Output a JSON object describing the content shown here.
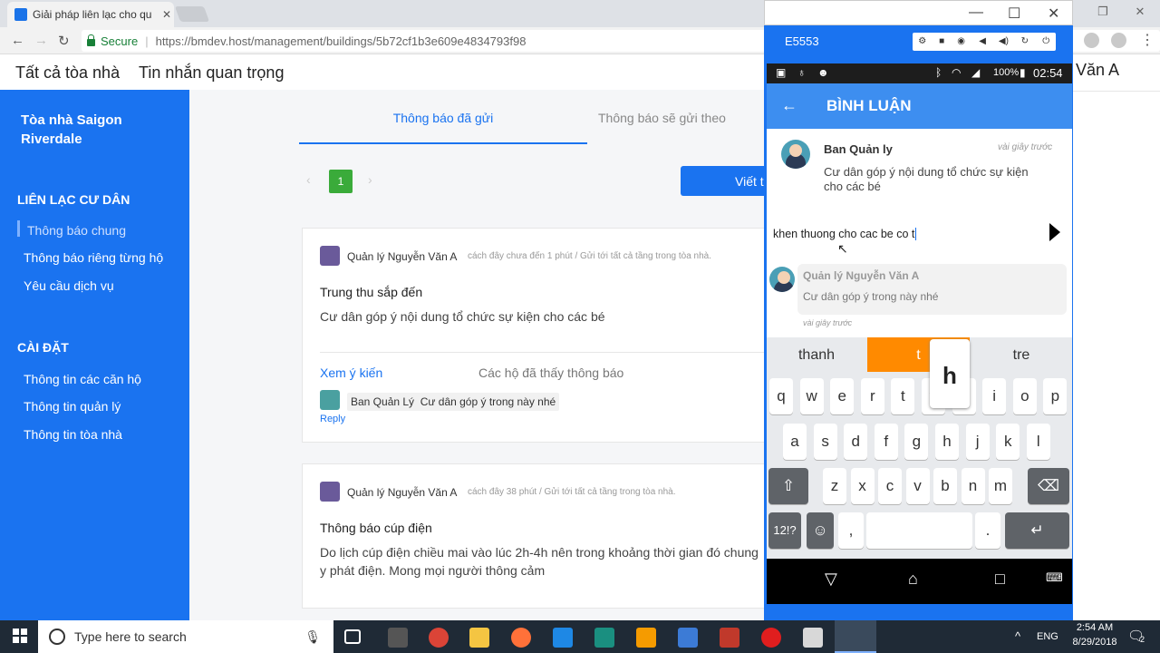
{
  "browser": {
    "tab_title": "Giải pháp liên lạc cho qu",
    "secure_label": "Secure",
    "url": "https://bmdev.host/management/buildings/5b72cf1b3e609e4834793f98"
  },
  "topnav": {
    "items": [
      "Tất cả tòa nhà",
      "Tin nhắn quan trọng"
    ],
    "user_suffix": "Văn A"
  },
  "sidebar": {
    "title": "Tòa nhà Saigon Riverdale",
    "sec1": "LIÊN LẠC CƯ DÂN",
    "items1": [
      "Thông báo chung",
      "Thông báo riêng từng hộ",
      "Yêu cầu dịch vụ"
    ],
    "sec2": "CÀI ĐẶT",
    "items2": [
      "Thông tin các căn hộ",
      "Thông tin quản lý",
      "Thông tin tòa nhà"
    ]
  },
  "main": {
    "tabs": [
      "Thông báo đã gửi",
      "Thông báo sẽ gửi theo"
    ],
    "page_prev": "‹",
    "page": "1",
    "page_next": "›",
    "write_button": "Viết t",
    "posts": [
      {
        "author": "Quản lý Nguyễn Văn A",
        "meta": "cách đây chưa đến 1 phút / Gửi tới tất cả tầng trong tòa nhà.",
        "title": "Trung thu sắp đến",
        "body": "Cư dân góp ý nội dung tổ chức sự kiện cho các bé",
        "view_comments": "Xem ý kiến",
        "seen_label": "Các hộ đã thấy thông báo",
        "comment_author": "Ban Quản Lý",
        "comment_text": "Cư dân góp ý trong này nhé",
        "reply": "Reply"
      },
      {
        "author": "Quản lý Nguyễn Văn A",
        "meta": "cách đây 38 phút / Gửi tới tất cả tầng trong tòa nhà.",
        "title": "Thông báo cúp điện",
        "body": "Do lịch cúp điện chiều mai vào lúc 2h-4h nên trong khoảng thời gian đó chung",
        "body2": "y phát điện. Mong mọi người thông cảm"
      }
    ]
  },
  "emulator": {
    "device": "E5553",
    "status_battery": "100%",
    "status_time": "02:54",
    "screen_title": "BÌNH LUẬN",
    "post_author": "Ban Quản ly",
    "post_time": "vài giây trước",
    "post_text": "Cư dân góp ý nội dung tổ chức sự kiện cho các bé",
    "input_text": "khen thuong cho cac be co t",
    "comment_author": "Quản lý Nguyễn Văn A",
    "comment_text": "Cư dân góp ý trong này nhé",
    "comment_time": "vài giây trước",
    "suggestions": [
      "thanh",
      "t",
      "tre"
    ],
    "popup_key": "h",
    "row1": [
      "q",
      "w",
      "e",
      "r",
      "t",
      "y",
      "u",
      "i",
      "o",
      "p"
    ],
    "row2": [
      "a",
      "s",
      "d",
      "f",
      "g",
      "h",
      "j",
      "k",
      "l"
    ],
    "row3": [
      "z",
      "x",
      "c",
      "v",
      "b",
      "n",
      "m"
    ],
    "sym_key": "12!?",
    "comma": ",",
    "period": "."
  },
  "taskbar": {
    "search_placeholder": "Type here to search",
    "lang": "ENG",
    "time": "2:54 AM",
    "date": "8/29/2018",
    "notif_count": "2"
  }
}
